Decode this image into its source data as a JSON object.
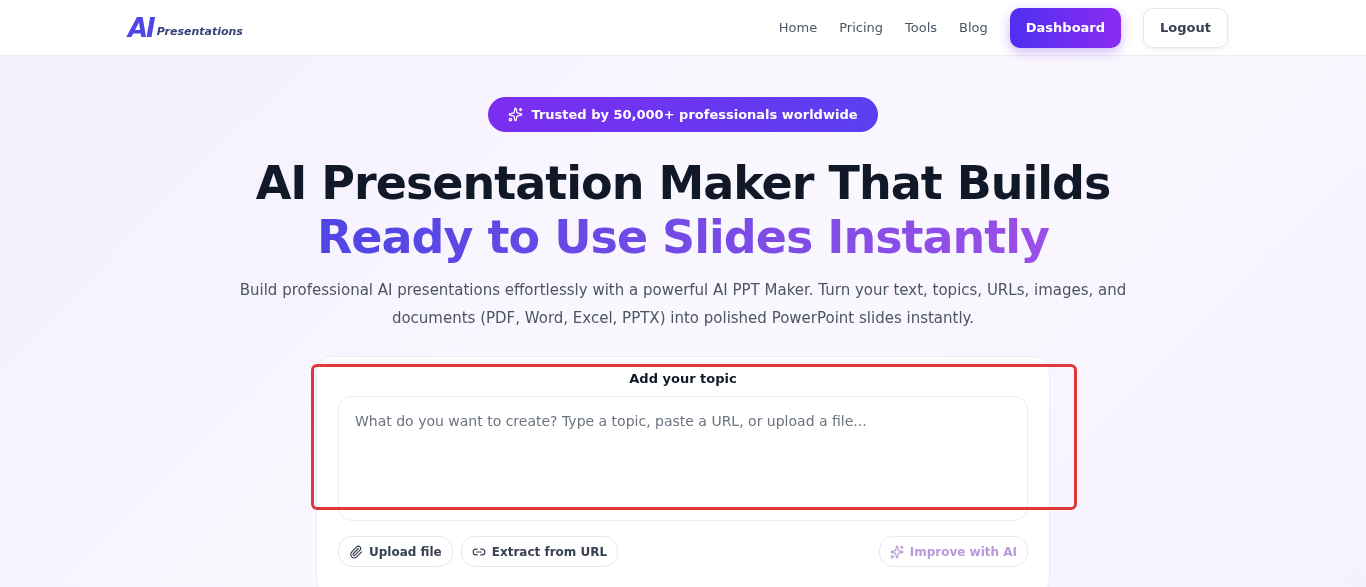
{
  "header": {
    "logo": {
      "mark": "AI",
      "text": "Presentations"
    },
    "nav": [
      {
        "label": "Home",
        "kind": "link"
      },
      {
        "label": "Pricing",
        "kind": "link"
      },
      {
        "label": "Tools",
        "kind": "link"
      },
      {
        "label": "Blog",
        "kind": "link"
      },
      {
        "label": "Dashboard",
        "kind": "primary"
      },
      {
        "label": "Logout",
        "kind": "outline"
      }
    ]
  },
  "hero": {
    "badge": "Trusted by 50,000+ professionals worldwide",
    "title_line_1": "AI Presentation Maker That Builds",
    "title_line_2": "Ready to Use Slides Instantly",
    "subtitle": "Build professional AI presentations effortlessly with a powerful AI PPT Maker. Turn your text, topics, URLs, images, and documents (PDF, Word, Excel, PPTX) into polished PowerPoint slides instantly."
  },
  "composer": {
    "label": "Add your topic",
    "placeholder": "What do you want to create? Type a topic, paste a URL, or upload a file...",
    "actions": [
      {
        "label": "Upload file",
        "kind": "upload",
        "disabled": false
      },
      {
        "label": "Extract from URL",
        "kind": "link",
        "disabled": false
      },
      {
        "label": "Improve with AI",
        "kind": "improve",
        "disabled": true
      }
    ]
  }
}
